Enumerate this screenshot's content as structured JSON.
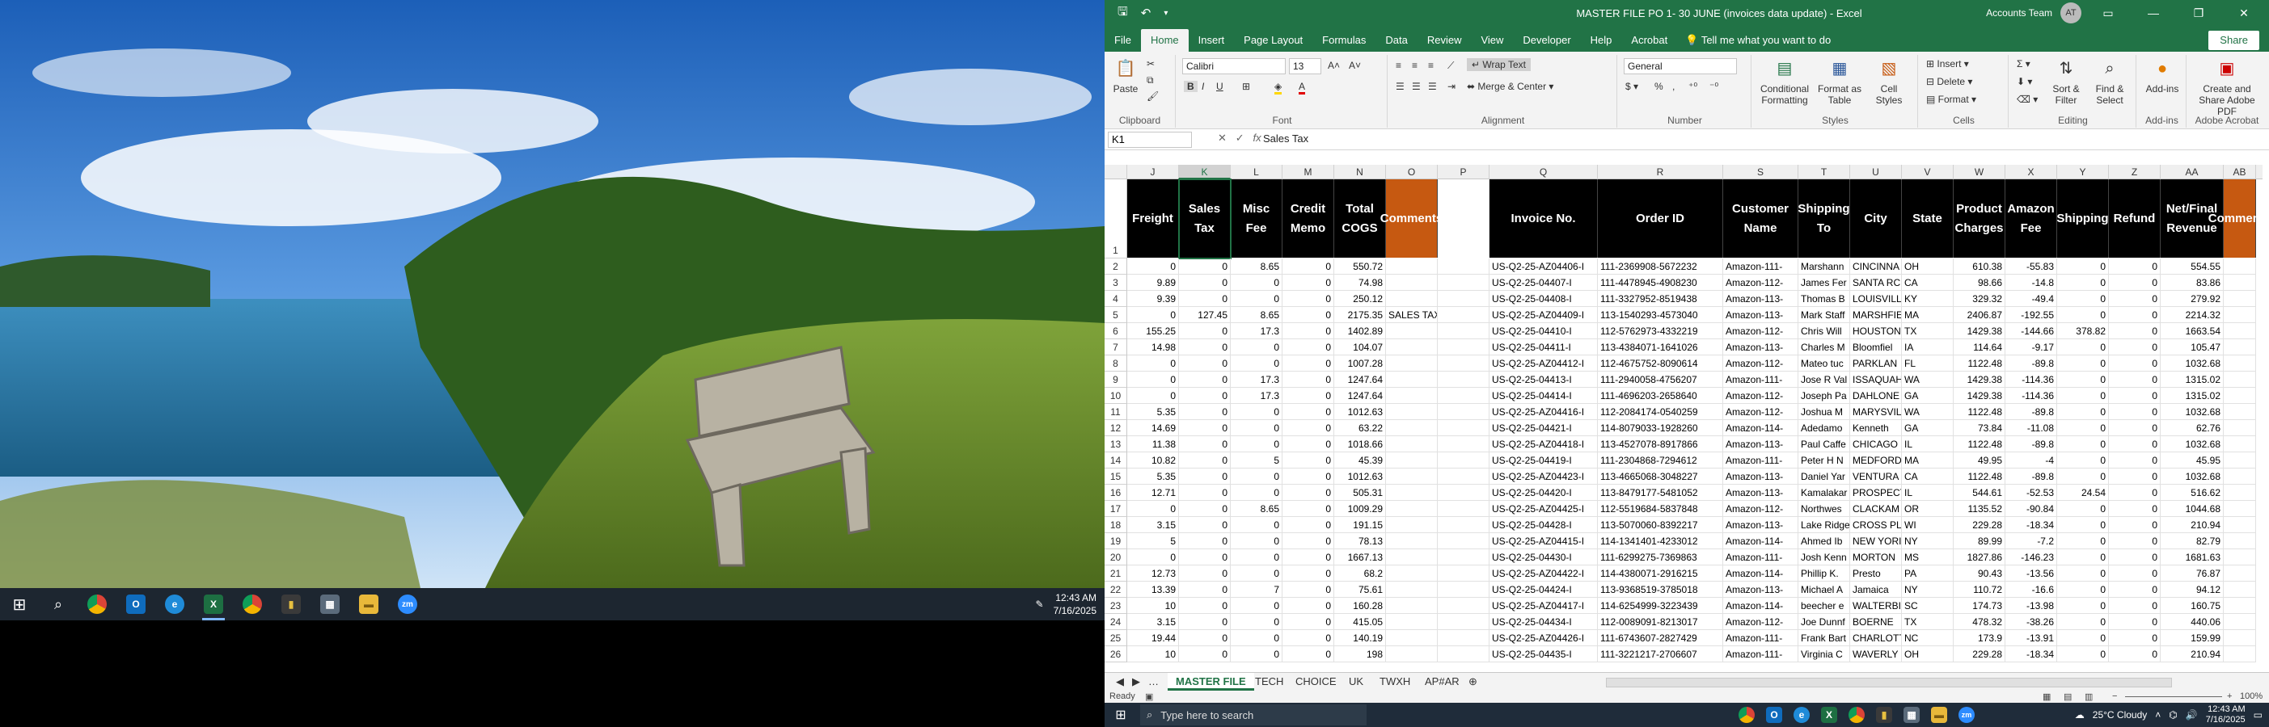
{
  "left_taskbar": {
    "time": "12:43 AM",
    "date": "7/16/2025",
    "apps": [
      {
        "name": "windows-start",
        "glyph": "⊞"
      },
      {
        "name": "search",
        "glyph": "⌕"
      },
      {
        "name": "chrome",
        "glyph": "",
        "color": "#db4437"
      },
      {
        "name": "outlook",
        "glyph": "O",
        "color": "#0f6cbd"
      },
      {
        "name": "edge",
        "glyph": "e",
        "color": "#1f8bd8"
      },
      {
        "name": "excel",
        "glyph": "X",
        "color": "#1d6f42"
      },
      {
        "name": "chrome-2",
        "glyph": "",
        "color": "#db4437"
      },
      {
        "name": "app-dark",
        "glyph": "▮",
        "color": "#3a3a3a"
      },
      {
        "name": "calculator",
        "glyph": "▦",
        "color": "#5b6b7b"
      },
      {
        "name": "file-explorer",
        "glyph": "▬",
        "color": "#e8b83a"
      },
      {
        "name": "zoom",
        "glyph": "zm",
        "color": "#2d8cff"
      }
    ]
  },
  "excel": {
    "title": "MASTER FILE PO 1- 30 JUNE (invoices data update)  -  Excel",
    "account": "Accounts Team",
    "avatar": "AT",
    "tabs": [
      "File",
      "Home",
      "Insert",
      "Page Layout",
      "Formulas",
      "Data",
      "Review",
      "View",
      "Developer",
      "Help",
      "Acrobat"
    ],
    "active_tab": "Home",
    "tell_me": "Tell me what you want to do",
    "share": "Share",
    "ribbon": {
      "clipboard": {
        "label": "Clipboard",
        "paste": "Paste"
      },
      "font": {
        "label": "Font",
        "name": "Calibri",
        "size": "13"
      },
      "alignment": {
        "label": "Alignment",
        "wrap": "Wrap Text",
        "merge": "Merge & Center"
      },
      "number": {
        "label": "Number",
        "format": "General"
      },
      "styles": {
        "label": "Styles",
        "conditional": "Conditional Formatting",
        "format_table": "Format as Table",
        "cell_styles": "Cell Styles"
      },
      "cells": {
        "label": "Cells",
        "insert": "Insert",
        "delete": "Delete",
        "format": "Format"
      },
      "editing": {
        "label": "Editing",
        "sort": "Sort & Filter",
        "find": "Find & Select"
      },
      "addins": {
        "label": "Add-ins",
        "addins": "Add-ins"
      },
      "acrobat": {
        "label": "Adobe Acrobat",
        "create": "Create and Share Adobe PDF"
      }
    },
    "name_box": "K1",
    "formula": "Sales Tax",
    "columns": [
      "J",
      "K",
      "L",
      "M",
      "N",
      "O",
      "P",
      "Q",
      "R",
      "S",
      "T",
      "U",
      "V",
      "W",
      "X",
      "Y",
      "Z",
      "AA",
      "AB"
    ],
    "headers": [
      "Freight",
      "Sales Tax",
      "Misc Fee",
      "Credit Memo",
      "Total COGS",
      "Comments",
      "",
      "Invoice No.",
      "Order ID",
      "Customer Name",
      "Shipping To",
      "City",
      "State",
      "Product Charges",
      "Amazon Fee",
      "Shipping",
      "Refund",
      "Net/Final Revenue",
      "Comments"
    ],
    "rows": [
      {
        "n": 2,
        "c": [
          "0",
          "0",
          "8.65",
          "0",
          "550.72",
          "",
          "",
          "US-Q2-25-AZ04406-I",
          "111-2369908-5672232",
          "Amazon-111-",
          "Marshann",
          "CINCINNA",
          "OH",
          "610.38",
          "-55.83",
          "0",
          "0",
          "554.55"
        ]
      },
      {
        "n": 3,
        "c": [
          "9.89",
          "0",
          "0",
          "0",
          "74.98",
          "",
          "",
          "US-Q2-25-04407-I",
          "111-4478945-4908230",
          "Amazon-112-",
          "James Fer",
          "SANTA RC",
          "CA",
          "98.66",
          "-14.8",
          "0",
          "0",
          "83.86"
        ]
      },
      {
        "n": 4,
        "c": [
          "9.39",
          "0",
          "0",
          "0",
          "250.12",
          "",
          "",
          "US-Q2-25-04408-I",
          "111-3327952-8519438",
          "Amazon-113-",
          "Thomas B",
          "LOUISVILL",
          "KY",
          "329.32",
          "-49.4",
          "0",
          "0",
          "279.92"
        ]
      },
      {
        "n": 5,
        "c": [
          "0",
          "127.45",
          "8.65",
          "0",
          "2175.35",
          "SALES TAX",
          "",
          "US-Q2-25-AZ04409-I",
          "113-1540293-4573040",
          "Amazon-113-",
          "Mark Staff",
          "MARSHFIE",
          "MA",
          "2406.87",
          "-192.55",
          "0",
          "0",
          "2214.32"
        ]
      },
      {
        "n": 6,
        "c": [
          "155.25",
          "0",
          "17.3",
          "0",
          "1402.89",
          "",
          "",
          "US-Q2-25-04410-I",
          "112-5762973-4332219",
          "Amazon-112-",
          "Chris Will",
          "HOUSTON",
          "TX",
          "1429.38",
          "-144.66",
          "378.82",
          "0",
          "1663.54"
        ]
      },
      {
        "n": 7,
        "c": [
          "14.98",
          "0",
          "0",
          "0",
          "104.07",
          "",
          "",
          "US-Q2-25-04411-I",
          "113-4384071-1641026",
          "Amazon-113-",
          "Charles M",
          "Bloomfiel",
          "IA",
          "114.64",
          "-9.17",
          "0",
          "0",
          "105.47"
        ]
      },
      {
        "n": 8,
        "c": [
          "0",
          "0",
          "0",
          "0",
          "1007.28",
          "",
          "",
          "US-Q2-25-AZ04412-I",
          "112-4675752-8090614",
          "Amazon-112-",
          "Mateo tuc",
          "PARKLAN",
          "FL",
          "1122.48",
          "-89.8",
          "0",
          "0",
          "1032.68"
        ]
      },
      {
        "n": 9,
        "c": [
          "0",
          "0",
          "17.3",
          "0",
          "1247.64",
          "",
          "",
          "US-Q2-25-04413-I",
          "111-2940058-4756207",
          "Amazon-111-",
          "Jose R Val",
          "ISSAQUAH",
          "WA",
          "1429.38",
          "-114.36",
          "0",
          "0",
          "1315.02"
        ]
      },
      {
        "n": 10,
        "c": [
          "0",
          "0",
          "17.3",
          "0",
          "1247.64",
          "",
          "",
          "US-Q2-25-04414-I",
          "111-4696203-2658640",
          "Amazon-112-",
          "Joseph Pa",
          "DAHLONE",
          "GA",
          "1429.38",
          "-114.36",
          "0",
          "0",
          "1315.02"
        ]
      },
      {
        "n": 11,
        "c": [
          "5.35",
          "0",
          "0",
          "0",
          "1012.63",
          "",
          "",
          "US-Q2-25-AZ04416-I",
          "112-2084174-0540259",
          "Amazon-112-",
          "Joshua M",
          "MARYSVIL",
          "WA",
          "1122.48",
          "-89.8",
          "0",
          "0",
          "1032.68"
        ]
      },
      {
        "n": 12,
        "c": [
          "14.69",
          "0",
          "0",
          "0",
          "63.22",
          "",
          "",
          "US-Q2-25-04421-I",
          "114-8079033-1928260",
          "Amazon-114-",
          "Adedamo",
          "Kenneth",
          "GA",
          "73.84",
          "-11.08",
          "0",
          "0",
          "62.76"
        ]
      },
      {
        "n": 13,
        "c": [
          "11.38",
          "0",
          "0",
          "0",
          "1018.66",
          "",
          "",
          "US-Q2-25-AZ04418-I",
          "113-4527078-8917866",
          "Amazon-113-",
          "Paul Caffe",
          "CHICAGO",
          "IL",
          "1122.48",
          "-89.8",
          "0",
          "0",
          "1032.68"
        ]
      },
      {
        "n": 14,
        "c": [
          "10.82",
          "0",
          "5",
          "0",
          "45.39",
          "",
          "",
          "US-Q2-25-04419-I",
          "111-2304868-7294612",
          "Amazon-111-",
          "Peter H N",
          "MEDFORD",
          "MA",
          "49.95",
          "-4",
          "0",
          "0",
          "45.95"
        ]
      },
      {
        "n": 15,
        "c": [
          "5.35",
          "0",
          "0",
          "0",
          "1012.63",
          "",
          "",
          "US-Q2-25-AZ04423-I",
          "113-4665068-3048227",
          "Amazon-113-",
          "Daniel Yar",
          "VENTURA",
          "CA",
          "1122.48",
          "-89.8",
          "0",
          "0",
          "1032.68"
        ]
      },
      {
        "n": 16,
        "c": [
          "12.71",
          "0",
          "0",
          "0",
          "505.31",
          "",
          "",
          "US-Q2-25-04420-I",
          "113-8479177-5481052",
          "Amazon-113-",
          "Kamalakar",
          "PROSPECT",
          "IL",
          "544.61",
          "-52.53",
          "24.54",
          "0",
          "516.62"
        ]
      },
      {
        "n": 17,
        "c": [
          "0",
          "0",
          "8.65",
          "0",
          "1009.29",
          "",
          "",
          "US-Q2-25-AZ04425-I",
          "112-5519684-5837848",
          "Amazon-112-",
          "Northwes",
          "CLACKAM",
          "OR",
          "1135.52",
          "-90.84",
          "0",
          "0",
          "1044.68"
        ]
      },
      {
        "n": 18,
        "c": [
          "3.15",
          "0",
          "0",
          "0",
          "191.15",
          "",
          "",
          "US-Q2-25-04428-I",
          "113-5070060-8392217",
          "Amazon-113-",
          "Lake Ridge",
          "CROSS PL",
          "WI",
          "229.28",
          "-18.34",
          "0",
          "0",
          "210.94"
        ]
      },
      {
        "n": 19,
        "c": [
          "5",
          "0",
          "0",
          "0",
          "78.13",
          "",
          "",
          "US-Q2-25-AZ04415-I",
          "114-1341401-4233012",
          "Amazon-114-",
          "Ahmed Ib",
          "NEW YORI",
          "NY",
          "89.99",
          "-7.2",
          "0",
          "0",
          "82.79"
        ]
      },
      {
        "n": 20,
        "c": [
          "0",
          "0",
          "0",
          "0",
          "1667.13",
          "",
          "",
          "US-Q2-25-04430-I",
          "111-6299275-7369863",
          "Amazon-111-",
          "Josh Kenn",
          "MORTON",
          "MS",
          "1827.86",
          "-146.23",
          "0",
          "0",
          "1681.63"
        ]
      },
      {
        "n": 21,
        "c": [
          "12.73",
          "0",
          "0",
          "0",
          "68.2",
          "",
          "",
          "US-Q2-25-AZ04422-I",
          "114-4380071-2916215",
          "Amazon-114-",
          "Phillip K.",
          "Presto",
          "PA",
          "90.43",
          "-13.56",
          "0",
          "0",
          "76.87"
        ]
      },
      {
        "n": 22,
        "c": [
          "13.39",
          "0",
          "7",
          "0",
          "75.61",
          "",
          "",
          "US-Q2-25-04424-I",
          "113-9368519-3785018",
          "Amazon-113-",
          "Michael A",
          "Jamaica",
          "NY",
          "110.72",
          "-16.6",
          "0",
          "0",
          "94.12"
        ]
      },
      {
        "n": 23,
        "c": [
          "10",
          "0",
          "0",
          "0",
          "160.28",
          "",
          "",
          "US-Q2-25-AZ04417-I",
          "114-6254999-3223439",
          "Amazon-114-",
          "beecher e",
          "WALTERBI",
          "SC",
          "174.73",
          "-13.98",
          "0",
          "0",
          "160.75"
        ]
      },
      {
        "n": 24,
        "c": [
          "3.15",
          "0",
          "0",
          "0",
          "415.05",
          "",
          "",
          "US-Q2-25-04434-I",
          "112-0089091-8213017",
          "Amazon-112-",
          "Joe Dunnf",
          "BOERNE",
          "TX",
          "478.32",
          "-38.26",
          "0",
          "0",
          "440.06"
        ]
      },
      {
        "n": 25,
        "c": [
          "19.44",
          "0",
          "0",
          "0",
          "140.19",
          "",
          "",
          "US-Q2-25-AZ04426-I",
          "111-6743607-2827429",
          "Amazon-111-",
          "Frank Bart",
          "CHARLOTT",
          "NC",
          "173.9",
          "-13.91",
          "0",
          "0",
          "159.99"
        ]
      },
      {
        "n": 26,
        "c": [
          "10",
          "0",
          "0",
          "0",
          "198",
          "",
          "",
          "US-Q2-25-04435-I",
          "111-3221217-2706607",
          "Amazon-111-",
          "Virginia C",
          "WAVERLY",
          "OH",
          "229.28",
          "-18.34",
          "0",
          "0",
          "210.94"
        ]
      }
    ],
    "sheet_tabs": [
      "MASTER FILE",
      "TECH",
      "CHOICE",
      "UK",
      "TWXH",
      "AP#AR"
    ],
    "active_sheet": "MASTER FILE",
    "status": "Ready",
    "zoom": "100%"
  },
  "right_taskbar": {
    "search_placeholder": "Type here to search",
    "weather": "25°C  Cloudy",
    "time": "12:43 AM",
    "date": "7/16/2025"
  }
}
